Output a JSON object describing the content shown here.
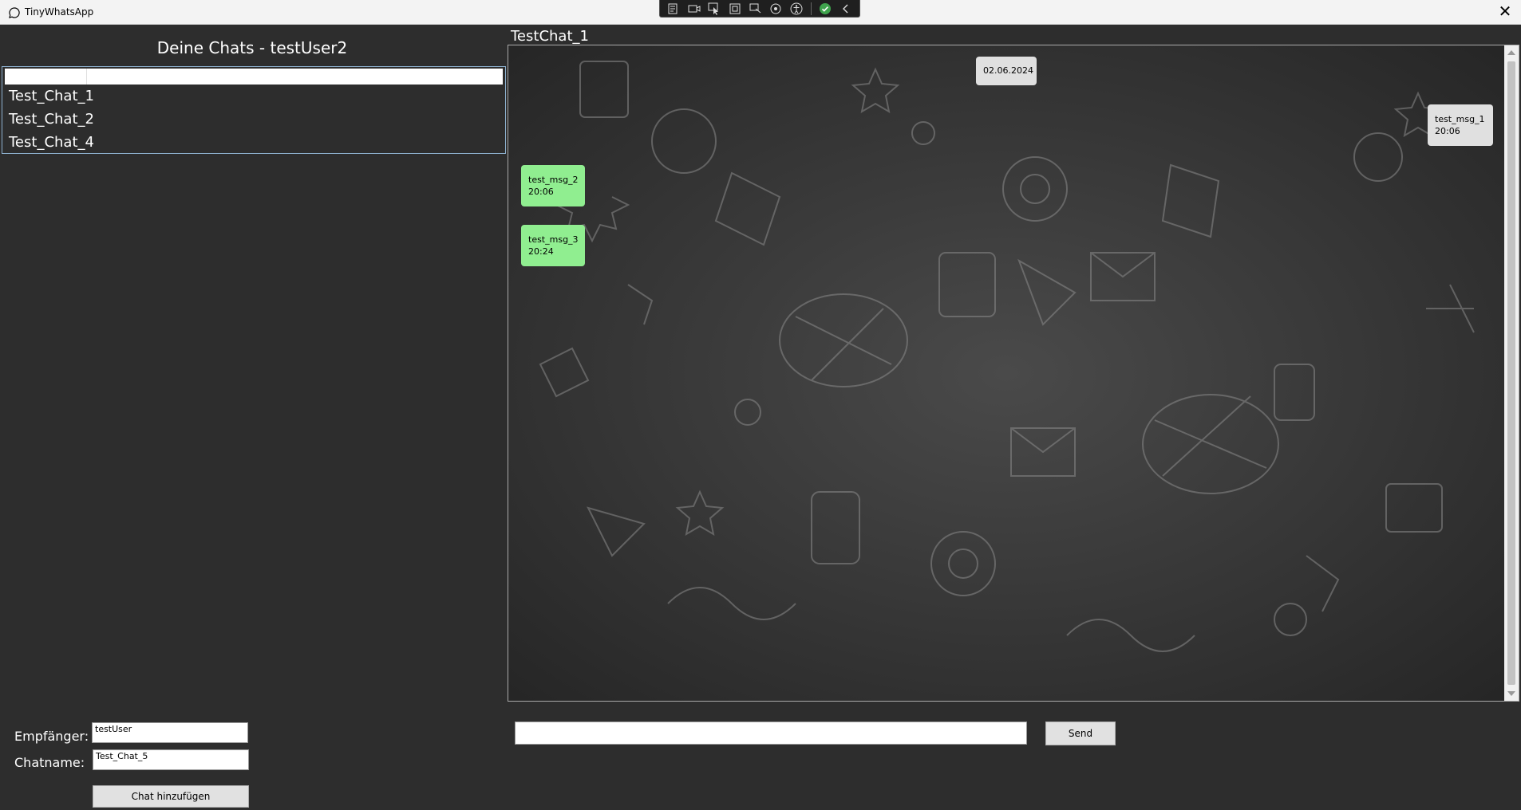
{
  "window": {
    "title": "TinyWhatsApp"
  },
  "sidebar": {
    "heading": "Deine Chats - testUser2",
    "search_value": "",
    "chats": [
      "Test_Chat_1",
      "Test_Chat_2",
      "Test_Chat_4"
    ]
  },
  "form": {
    "recipient_label": "Empfänger:",
    "recipient_value": "testUser",
    "chatname_label": "Chatname:",
    "chatname_value": "Test_Chat_5",
    "add_button_label": "Chat hinzufügen"
  },
  "chat": {
    "title": "TestChat_1",
    "date": "02.06.2024",
    "messages": [
      {
        "text": "test_msg_1",
        "time": "20:06",
        "direction": "outgoing"
      },
      {
        "text": "test_msg_2",
        "time": "20:06",
        "direction": "incoming"
      },
      {
        "text": "test_msg_3",
        "time": "20:24",
        "direction": "incoming"
      }
    ]
  },
  "composer": {
    "input_value": "",
    "send_label": "Send"
  },
  "colors": {
    "background": "#2d2d2d",
    "incoming_bubble": "#90ee90",
    "outgoing_bubble": "#e0e0e0",
    "chat_wallpaper": "#3a3a3a"
  }
}
